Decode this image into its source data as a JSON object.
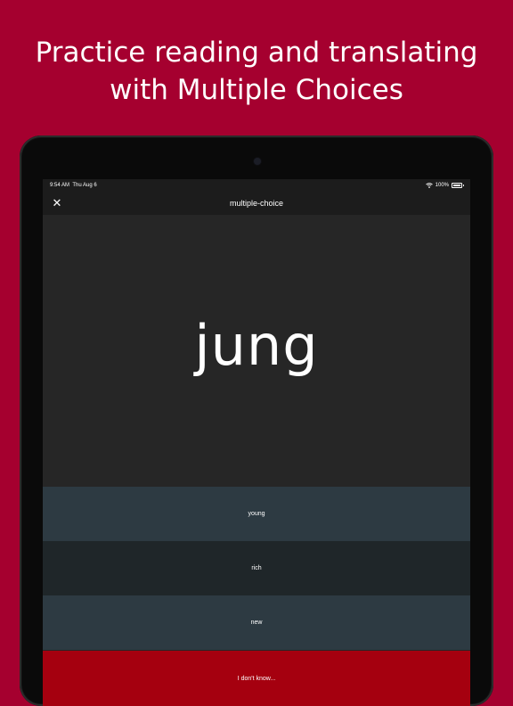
{
  "headline": {
    "line1": "Practice reading and translating",
    "line2": "with Multiple Choices"
  },
  "status_bar": {
    "time": "9:54 AM",
    "date": "Thu Aug 6",
    "battery": "100%",
    "icons": [
      "wifi-icon",
      "battery-icon"
    ]
  },
  "nav": {
    "title": "multiple-choice",
    "close_label": "✕"
  },
  "card": {
    "word": "jung"
  },
  "options": [
    {
      "label": "young"
    },
    {
      "label": "rich"
    },
    {
      "label": "new"
    }
  ],
  "dont_know": {
    "label": "I don't know..."
  },
  "colors": {
    "background": "#a5002f",
    "option_dark": "#2d3a42",
    "option_darker": "#1f2629",
    "dont_know": "#a5000f"
  }
}
